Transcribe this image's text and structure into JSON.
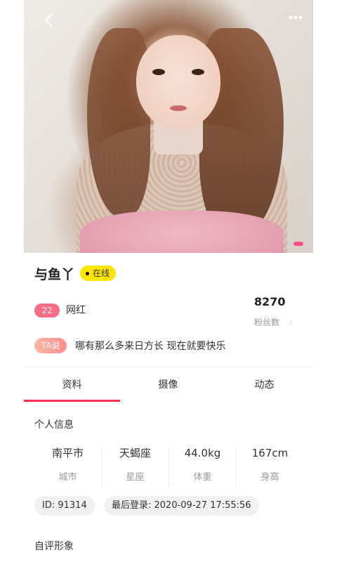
{
  "profile": {
    "name": "与鱼丫",
    "status": "在线",
    "age": "22",
    "tag": "网红",
    "fans_count": "8270",
    "fans_label": "粉丝数",
    "ta_badge": "TA说",
    "ta_text": "哪有那么多来日方长 现在就要快乐"
  },
  "tabs": [
    {
      "label": "资料",
      "active": true
    },
    {
      "label": "摄像",
      "active": false
    },
    {
      "label": "动态",
      "active": false
    }
  ],
  "personal_info": {
    "title": "个人信息",
    "stats": [
      {
        "value": "南平市",
        "label": "城市"
      },
      {
        "value": "天蝎座",
        "label": "星座"
      },
      {
        "value": "44.0kg",
        "label": "体重"
      },
      {
        "value": "167cm",
        "label": "身高"
      }
    ],
    "id_chip": "ID: 91314",
    "last_login_chip": "最后登录: 2020-09-27 17:55:56"
  },
  "self_eval": {
    "title": "自评形象"
  },
  "colors": {
    "accent": "#ff2e55",
    "online_badge": "#ffe600",
    "age_badge": "#fb6c86",
    "carousel_dot": "#ff4f8b"
  },
  "icons": {
    "back": "chevron-left-icon",
    "more": "more-dots-icon"
  }
}
